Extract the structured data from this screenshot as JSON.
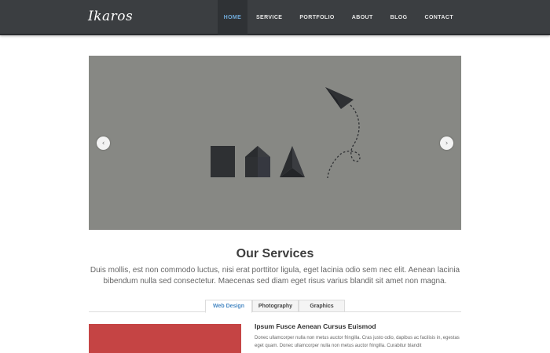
{
  "header": {
    "logo": "Ikaros",
    "nav": [
      "HOME",
      "SERVICE",
      "PORTFOLIO",
      "ABOUT",
      "BLOG",
      "CONTACT"
    ],
    "active_index": 0,
    "active_color": "#6fa9d8"
  },
  "slider": {
    "background": "#878884",
    "prev_icon": "‹",
    "next_icon": "›",
    "shapes": [
      "square",
      "house",
      "pyramid",
      "paper-plane"
    ]
  },
  "services": {
    "title": "Our Services",
    "description": "Duis mollis, est non commodo luctus, nisi erat porttitor ligula, eget lacinia odio sem nec elit. Aenean lacinia bibendum nulla sed consectetur. Maecenas sed diam eget risus varius blandit sit amet non magna."
  },
  "tabs": {
    "items": [
      "Web Design",
      "Photography",
      "Graphics"
    ],
    "active_index": 0
  },
  "content": {
    "image_color": "#c54444",
    "heading": "Ipsum Fusce Aenean Cursus Euismod",
    "text": "Donec ullamcorper nulla non metus auctor fringilla. Cras justo odio, dapibus ac facilisis in, egestas eget quam. Donec ullamcorper nulla non metus auctor fringilla. Curabitur blandit"
  }
}
